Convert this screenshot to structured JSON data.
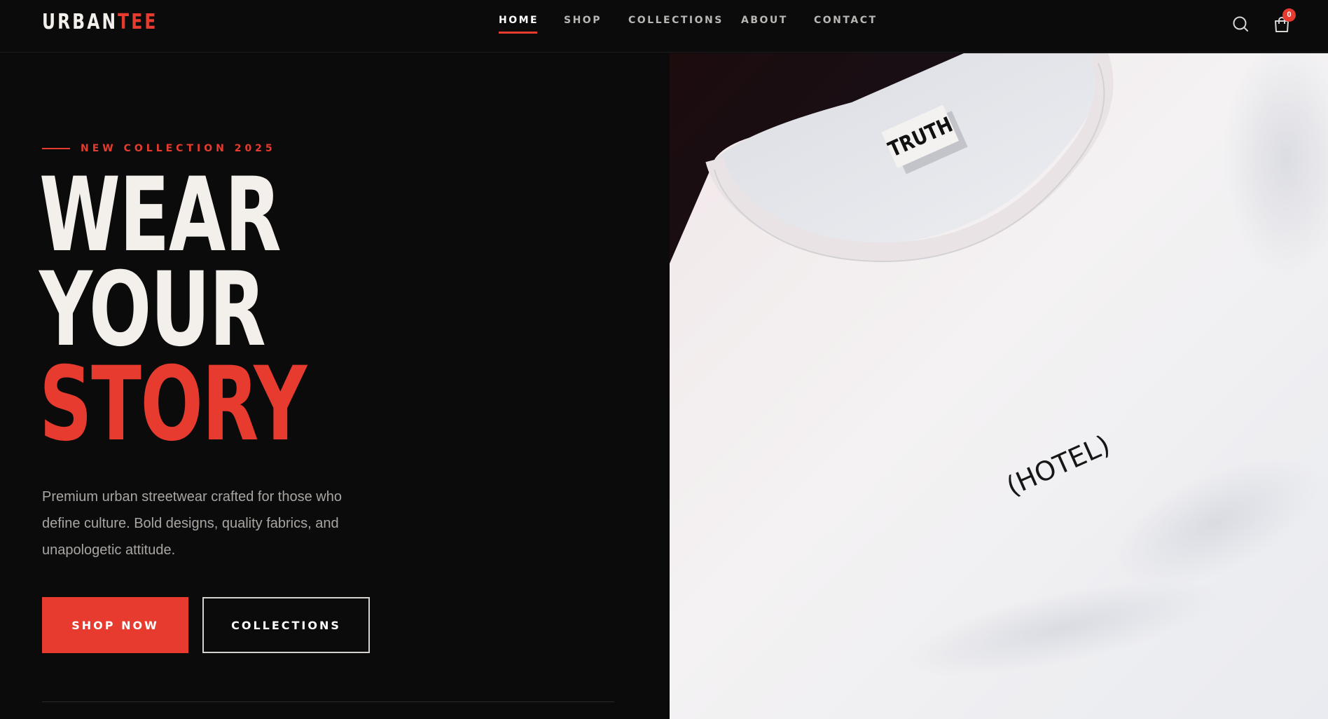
{
  "brand": {
    "part1": "URBAN",
    "part2": "TEE"
  },
  "nav": {
    "items": [
      {
        "label": "HOME",
        "active": true
      },
      {
        "label": "SHOP",
        "active": false
      },
      {
        "label": "COLLECTIONS",
        "active": false
      },
      {
        "label": "ABOUT",
        "active": false
      },
      {
        "label": "CONTACT",
        "active": false
      }
    ]
  },
  "header_icons": {
    "search": "search-icon",
    "cart": "shopping-bag-icon",
    "cart_count": "0"
  },
  "hero": {
    "eyebrow": "NEW COLLECTION 2025",
    "headline": [
      "WEAR",
      "YOUR",
      "STORY"
    ],
    "description": "Premium urban streetwear crafted for those who define culture. Bold designs, quality fabrics, and unapologetic attitude.",
    "primary_button": "SHOP NOW",
    "secondary_button": "COLLECTIONS"
  },
  "hero_image": {
    "tag_text": "TRUTH",
    "shirt_print": "(HOTEL)"
  },
  "colors": {
    "background": "#0b0b0c",
    "accent": "#e63b2e",
    "text": "#f3efea",
    "muted": "#a9a6a2"
  }
}
